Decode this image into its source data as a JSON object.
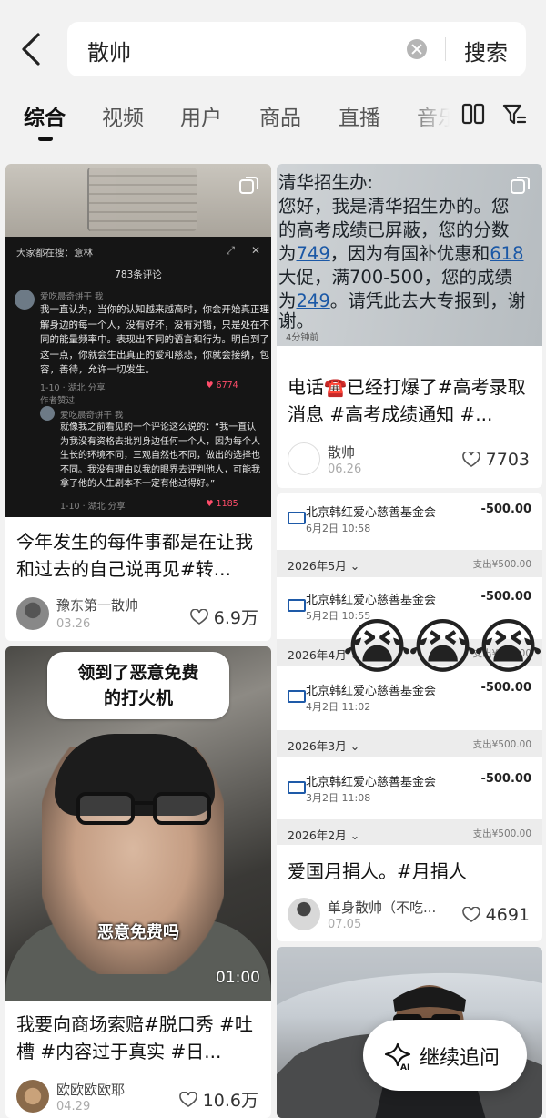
{
  "search": {
    "query": "散帅",
    "submit_label": "搜索"
  },
  "tabs": [
    {
      "label": "综合"
    },
    {
      "label": "视频"
    },
    {
      "label": "用户"
    },
    {
      "label": "商品"
    },
    {
      "label": "直播"
    },
    {
      "label": "音乐"
    }
  ],
  "cards": [
    {
      "title": "今年发生的每件事都是在让我和过去的自己说再见#转...",
      "author": "豫东第一散帅",
      "date": "03.26",
      "likes": "6.9万",
      "thumb": {
        "top_text": "大家都在搜：意林",
        "comment_count": "783条评论",
        "c1_name": "爱吃晨奇饼干 我",
        "c1_body": [
          "我一直认为，当你的认知越来越高时，你会开始真正理",
          "解身边的每一个人，没有好坏，没有对错，只是处在不",
          "同的能量频率中。表现出不同的语言和行为。明白到了",
          "这一点，你就会生出真正的爱和慈悲，你就会接纳，包",
          "容，善待，允许一切发生。"
        ],
        "c1_meta": "1-10 · 湖北    分享",
        "c1_likes": "♥ 6774",
        "c1_badge": "作者赞过",
        "c2_name": "爱吃晨奇饼干 我",
        "c2_body": [
          "就像我之前看见的一个评论这么说的：“我一直认",
          "为我没有资格去批判身边任何一个人，因为每个人",
          "生长的环境不同，三观自然也不同，做出的选择也",
          "不同。我没有理由以我的眼界去评判他人，可能我",
          "拿了他的人生剧本不一定有他过得好。”"
        ],
        "c2_meta": "1-10 · 湖北    分享",
        "c2_likes": "♥ 1185"
      }
    },
    {
      "title": "电话☎️已经打爆了#高考录取消息 #高考成绩通知 #...",
      "author": "散帅",
      "date": "06.26",
      "likes": "7703",
      "thumb": {
        "line1": "清华招生办:",
        "line2": "您好，我是清华招生办的。您",
        "line3": "的高考成绩已屏蔽，您的分数",
        "line4_pre": "为",
        "line4_n1": "749",
        "line4_mid": "，因为有国补优惠和",
        "line4_n2": "618",
        "line5": "大促，满700-500，您的成绩",
        "line6_pre": "为",
        "line6_n": "249",
        "line6_post": "。请凭此去大专报到，谢",
        "line7": "谢。",
        "time": "4分钟前"
      }
    },
    {
      "title": "爱国月捐人。#月捐人",
      "author": "单身散帅（不吃...",
      "date": "07.05",
      "likes": "4691",
      "thumb": {
        "org": "北京韩红爱心慈善基金会",
        "amount": "-500.00",
        "rows": [
          {
            "when": "6月2日 10:58"
          },
          {
            "when": "5月2日 10:55"
          },
          {
            "when": "4月2日 11:02"
          },
          {
            "when": "3月2日 11:08"
          }
        ],
        "months": [
          {
            "month": "2026年5月 ⌄",
            "sum": "支出¥500.00"
          },
          {
            "month": "2026年4月 ⌄",
            "sum": "支出¥500.00"
          },
          {
            "month": "2026年3月 ⌄",
            "sum": "支出¥500.00"
          },
          {
            "month": "2026年2月 ⌄",
            "sum": "支出¥500.00"
          }
        ],
        "emoji": "😭"
      }
    },
    {
      "title": "我要向商场索赔#脱口秀 #吐槽 #内容过于真实 #日...",
      "author": "欧欧欧欧耶",
      "date": "04.29",
      "likes": "10.6万",
      "thumb": {
        "caption_line1": "领到了恶意免费",
        "caption_line2": "的打火机",
        "subtitle": "恶意免费吗",
        "duration": "01:00"
      }
    }
  ],
  "ai_button": {
    "label": "继续追问"
  },
  "colors": {
    "background": "#f2f2f2",
    "link_blue": "#1b58a6",
    "like_red": "#ff4d6a"
  }
}
